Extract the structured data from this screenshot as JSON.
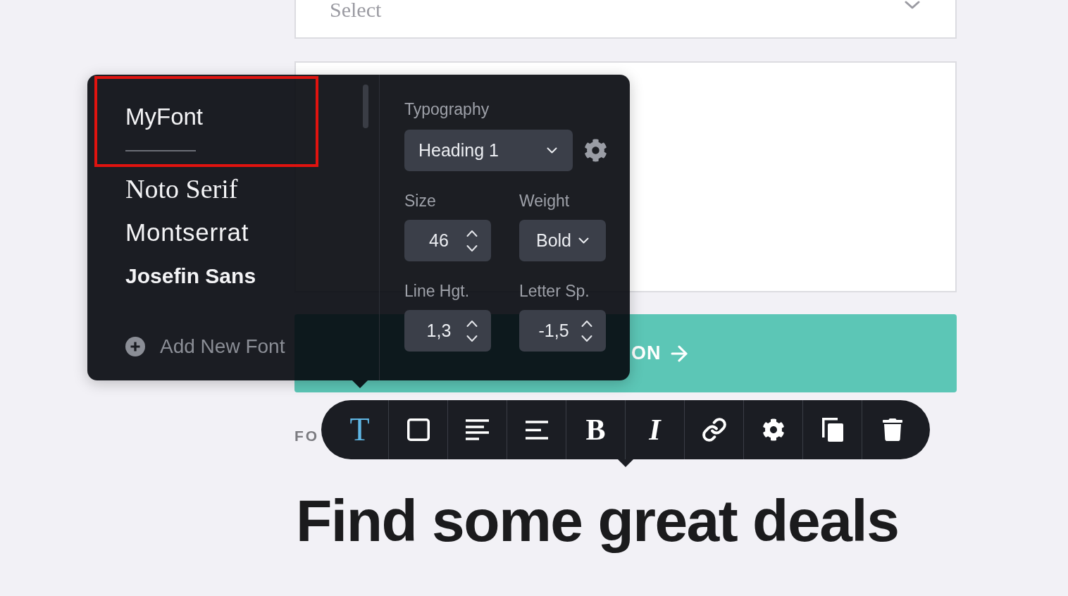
{
  "select_field": {
    "placeholder": "Select"
  },
  "cta_button": {
    "label": "ON"
  },
  "tagline": "FO",
  "heading": "Find some great deals",
  "font_menu": {
    "fonts": [
      {
        "name": "MyFont",
        "kind": "light",
        "selected": true,
        "highlighted": true
      },
      {
        "name": "Noto Serif",
        "kind": "serif",
        "selected": false,
        "highlighted": false
      },
      {
        "name": "Montserrat",
        "kind": "sans",
        "selected": false,
        "highlighted": false
      },
      {
        "name": "Josefin Sans",
        "kind": "bold",
        "selected": false,
        "highlighted": false
      }
    ],
    "add_font": "Add New Font"
  },
  "typography": {
    "title": "Typography",
    "style": "Heading 1",
    "size": {
      "label": "Size",
      "value": "46"
    },
    "weight": {
      "label": "Weight",
      "value": "Bold"
    },
    "line_height": {
      "label": "Line Hgt.",
      "value": "1,3"
    },
    "letter_spacing": {
      "label": "Letter Sp.",
      "value": "-1,5"
    }
  },
  "toolbar": {
    "tools": [
      {
        "kind": "glyph",
        "glyph": "T",
        "selected": true
      },
      {
        "kind": "icon",
        "selected": false
      },
      {
        "kind": "icon",
        "selected": false
      },
      {
        "kind": "icon",
        "selected": false
      },
      {
        "kind": "glyph",
        "glyph": "B",
        "selected": false
      },
      {
        "kind": "glyph",
        "glyph": "I",
        "selected": false
      },
      {
        "kind": "icon",
        "selected": false
      },
      {
        "kind": "icon",
        "selected": false
      },
      {
        "kind": "icon",
        "selected": false
      },
      {
        "kind": "icon",
        "selected": false
      }
    ]
  }
}
